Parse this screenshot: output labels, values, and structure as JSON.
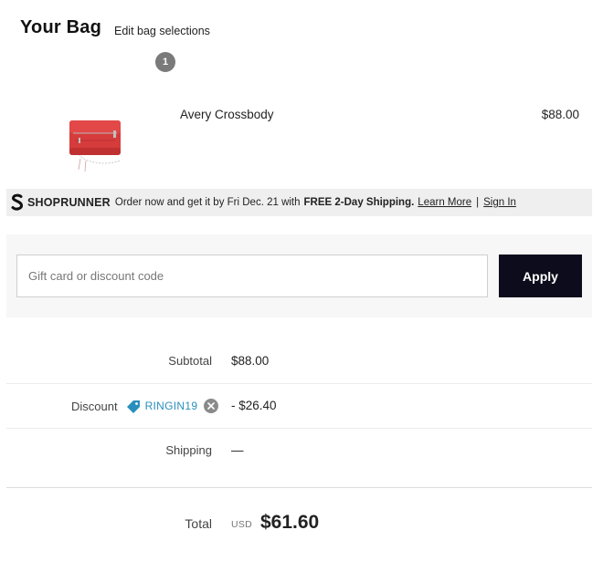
{
  "header": {
    "title": "Your Bag",
    "edit_link": "Edit bag selections",
    "item_count": "1"
  },
  "product": {
    "name": "Avery Crossbody",
    "price": "$88.00",
    "image_icon": "red-crossbody-bag-image"
  },
  "shoprunner": {
    "brand": "SHOPRUNNER",
    "message": "Order now and get it by Fri Dec. 21 with",
    "highlight": "FREE 2-Day Shipping.",
    "learn_more": "Learn More",
    "separator": "|",
    "sign_in": "Sign In"
  },
  "discount_form": {
    "placeholder": "Gift card or discount code",
    "value": "",
    "apply_label": "Apply"
  },
  "summary": {
    "subtotal_label": "Subtotal",
    "subtotal_value": "$88.00",
    "discount_label": "Discount",
    "discount_code": "RINGIN19",
    "discount_value": "- $26.40",
    "shipping_label": "Shipping",
    "shipping_value": "—",
    "total_label": "Total",
    "total_currency": "USD",
    "total_value": "$61.60"
  },
  "colors": {
    "apply_button_bg": "#0c0c1c",
    "discount_code": "#2a8fbd",
    "shoprunner_bar_bg": "#efefef",
    "badge_bg": "#7a7a7a"
  }
}
